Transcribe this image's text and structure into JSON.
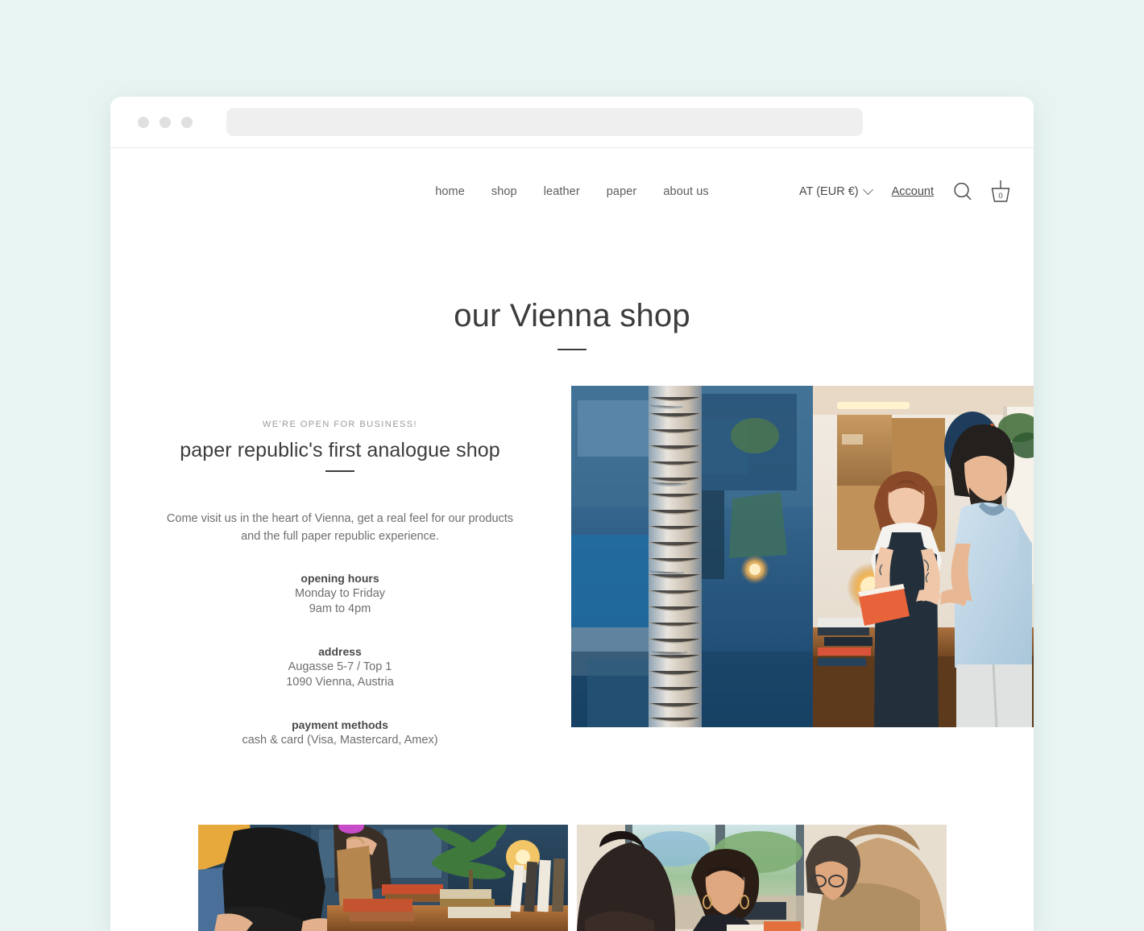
{
  "background_color": "#e7f4f2",
  "browser": {
    "traffic_lights": [
      "dot-1",
      "dot-2",
      "dot-3"
    ],
    "url_value": "",
    "url_placeholder": ""
  },
  "nav": {
    "links": [
      {
        "label": "home"
      },
      {
        "label": "shop"
      },
      {
        "label": "leather"
      },
      {
        "label": "paper"
      },
      {
        "label": "about us"
      }
    ],
    "currency_label": "AT (EUR €)",
    "currency_icon": "chevron-down-icon",
    "account_label": "Account",
    "search_icon": "search-icon",
    "cart_icon": "shopping-basket-icon",
    "cart_count": "0"
  },
  "page": {
    "title": "our Vienna shop"
  },
  "hero": {
    "eyebrow": "WE'RE OPEN FOR BUSINESS!",
    "heading": "paper republic's first analogue shop",
    "paragraph": "Come visit us in the heart of Vienna, get a real feel for our products and the full paper republic experience.",
    "info": [
      {
        "label": "opening hours",
        "lines": [
          "Monday to Friday",
          "9am to 4pm"
        ]
      },
      {
        "label": "address",
        "lines": [
          "Augasse 5-7 / Top 1",
          "1090 Vienna, Austria"
        ]
      },
      {
        "label": "payment methods",
        "lines": [
          "cash & card (Visa, Mastercard, Amex)"
        ]
      }
    ],
    "image_alt": "shop window with palm trunk, two people looking at an orange notebook inside the store"
  },
  "gallery": [
    {
      "alt": "customers at the counter with a kraft paper bag and notebooks"
    },
    {
      "alt": "workshop participants at a bright window bench"
    }
  ]
}
